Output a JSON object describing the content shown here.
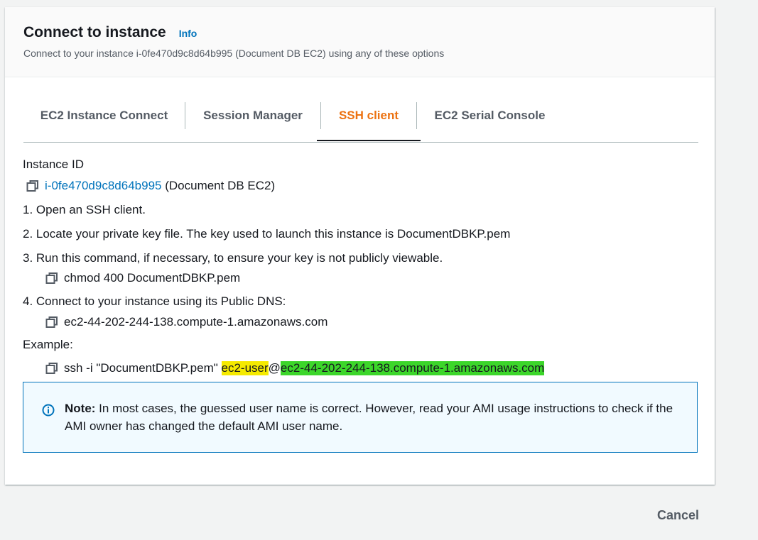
{
  "header": {
    "title": "Connect to instance",
    "info_label": "Info",
    "subtitle": "Connect to your instance i-0fe470d9c8d64b995 (Document DB EC2) using any of these options"
  },
  "tabs": [
    {
      "label": "EC2 Instance Connect",
      "active": false
    },
    {
      "label": "Session Manager",
      "active": false
    },
    {
      "label": "SSH client",
      "active": true
    },
    {
      "label": "EC2 Serial Console",
      "active": false
    }
  ],
  "instance": {
    "label": "Instance ID",
    "id": "i-0fe470d9c8d64b995",
    "name": "(Document DB EC2)"
  },
  "steps": [
    {
      "text": "1. Open an SSH client."
    },
    {
      "text": "2. Locate your private key file. The key used to launch this instance is DocumentDBKP.pem"
    },
    {
      "text": "3. Run this command, if necessary, to ensure your key is not publicly viewable.",
      "command": "chmod 400 DocumentDBKP.pem"
    },
    {
      "text": "4. Connect to your instance using its Public DNS:",
      "command": "ec2-44-202-244-138.compute-1.amazonaws.com"
    }
  ],
  "example": {
    "label": "Example:",
    "prefix": "ssh -i \"DocumentDBKP.pem\" ",
    "user": "ec2-user",
    "at": "@",
    "host": "ec2-44-202-244-138.compute-1.amazonaws.com"
  },
  "note": {
    "bold": "Note:",
    "text": " In most cases, the guessed user name is correct. However, read your AMI usage instructions to check if the AMI owner has changed the default AMI user name."
  },
  "footer": {
    "cancel_label": "Cancel"
  },
  "colors": {
    "accent": "#ec7211",
    "link": "#0073bb",
    "highlight_user": "#f5ea00",
    "highlight_host": "#3cd62a"
  },
  "icons": [
    "copy-icon",
    "info-circle-icon"
  ]
}
